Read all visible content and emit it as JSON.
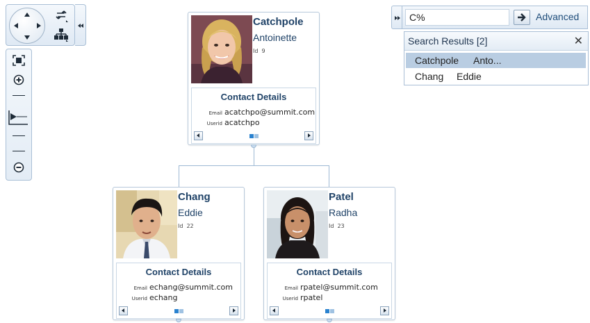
{
  "navigation": {
    "pan_icon": "pan-arrows-icon",
    "tools": [
      "swap-orientation-icon",
      "hierarchy-layout-icon"
    ],
    "collapse_icon": "double-chevron-left-icon"
  },
  "zoom": {
    "icons": [
      "fit-to-screen-icon",
      "zoom-in-icon",
      "zoom-out-icon"
    ],
    "level_fraction": 0.35
  },
  "nodes": [
    {
      "last_name": "Catchpole",
      "first_name": "Antoinette",
      "id_label": "Id",
      "id_value": "9",
      "photo": "woman-blonde-photo",
      "details": {
        "title": "Contact Details",
        "email_label": "Email",
        "email": "acatchpo@summit.com",
        "userid_label": "Userid",
        "userid": "acatchpo"
      }
    },
    {
      "last_name": "Chang",
      "first_name": "Eddie",
      "id_label": "Id",
      "id_value": "22",
      "photo": "man-black-hair-photo",
      "details": {
        "title": "Contact Details",
        "email_label": "Email",
        "email": "echang@summit.com",
        "userid_label": "Userid",
        "userid": "echang"
      }
    },
    {
      "last_name": "Patel",
      "first_name": "Radha",
      "id_label": "Id",
      "id_value": "23",
      "photo": "woman-dark-hair-photo",
      "details": {
        "title": "Contact Details",
        "email_label": "Email",
        "email": "rpatel@summit.com",
        "userid_label": "Userid",
        "userid": "rpatel"
      }
    }
  ],
  "search": {
    "query": "C%",
    "advanced_label": "Advanced",
    "results_title": "Search Results [2]",
    "close_glyph": "✕",
    "results": [
      {
        "last": "Catchpole",
        "first": "Anto...",
        "selected": true
      },
      {
        "last": "Chang",
        "first": "Eddie",
        "selected": false
      }
    ]
  },
  "colors": {
    "accent": "#1f4267",
    "selected_row": "#b9cde2",
    "connector": "#9cb8d3",
    "dot_active": "#2a82cf",
    "dot_inactive": "#9fc2e2"
  }
}
